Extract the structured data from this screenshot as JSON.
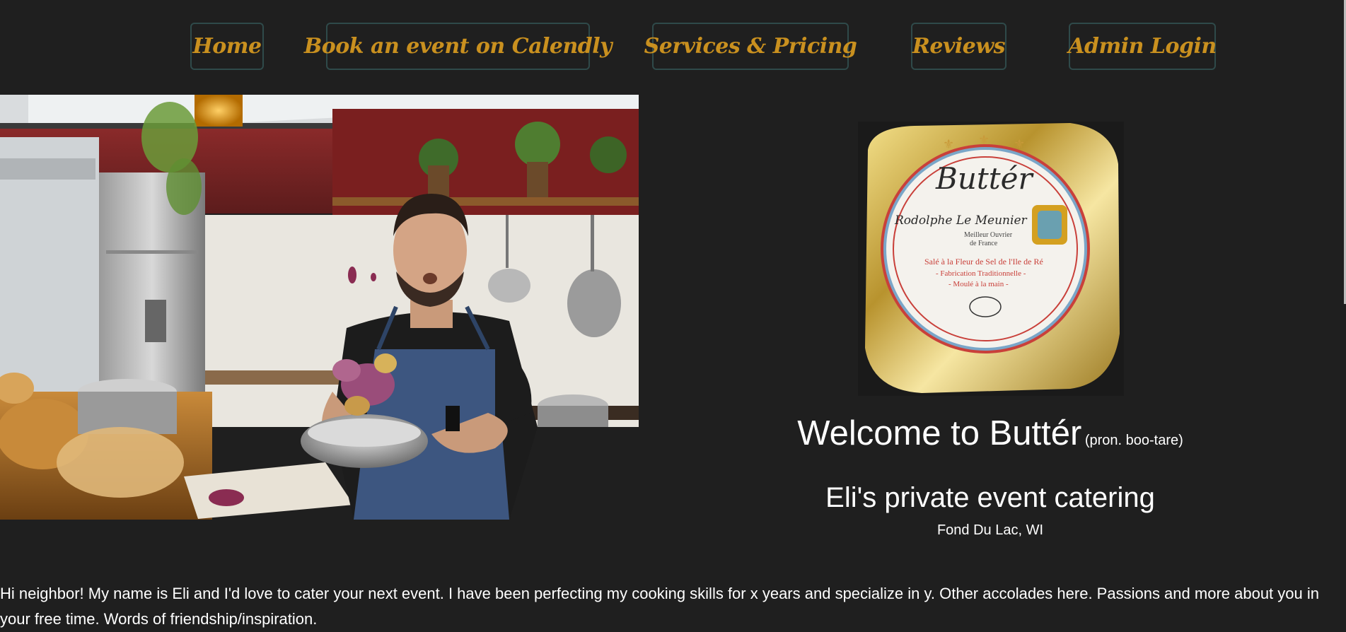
{
  "nav": {
    "items": [
      {
        "label": "Home"
      },
      {
        "label": "Book an event on Calendly"
      },
      {
        "label": "Services & Pricing"
      },
      {
        "label": "Reviews"
      },
      {
        "label": "Admin Login"
      }
    ]
  },
  "butter_package": {
    "brand": "Buttér",
    "signature": "Rodolphe Le Meunier",
    "title_line1": "Meilleur Ouvrier",
    "title_line2": "de France",
    "line1": "Salé à la Fleur de Sel de l'Ile de Ré",
    "line2": "- Fabrication Traditionnelle -",
    "line3": "- Moulé à la main -"
  },
  "hero": {
    "title": "Welcome to Buttér",
    "pronunciation": "(pron. boo-tare)",
    "subtitle": "Eli's private event catering",
    "location": "Fond Du Lac, WI"
  },
  "intro": {
    "text": "Hi neighbor! My name is Eli and I'd love to cater your next event. I have been perfecting my cooking skills for x years and specialize in y. Other accolades here. Passions and more about you in your free time. Words of friendship/inspiration."
  },
  "colors": {
    "background": "#1f1f1f",
    "nav_text": "#c9901f",
    "nav_border": "#2f4a4a"
  }
}
